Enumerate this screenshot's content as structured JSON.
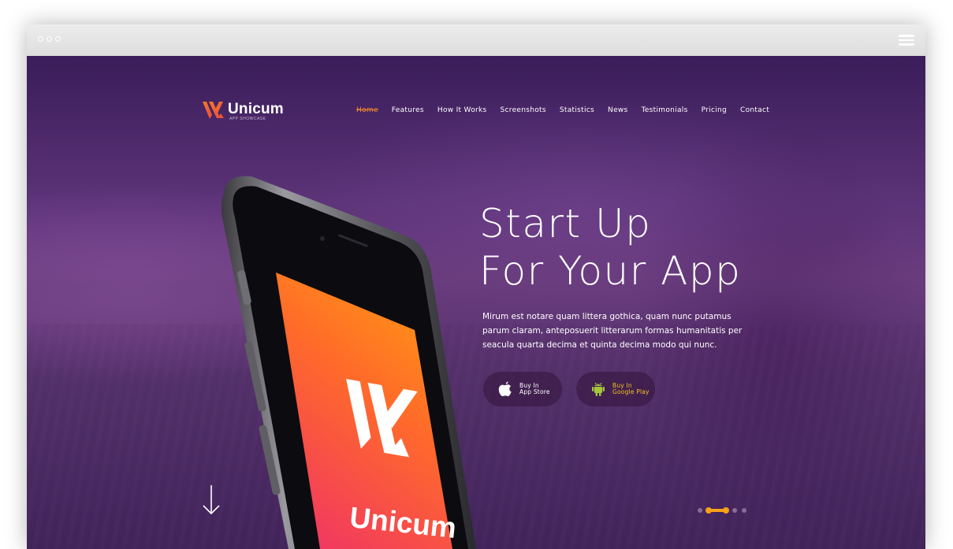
{
  "brand": {
    "name": "Unicum",
    "tagline": "APP SHOWCASE",
    "accent": "#f48a2c",
    "purple": "#4a2a62"
  },
  "nav": {
    "items": [
      {
        "label": "Home",
        "active": true
      },
      {
        "label": "Features",
        "active": false
      },
      {
        "label": "How It Works",
        "active": false
      },
      {
        "label": "Screenshots",
        "active": false
      },
      {
        "label": "Statistics",
        "active": false
      },
      {
        "label": "News",
        "active": false
      },
      {
        "label": "Testimonials",
        "active": false
      },
      {
        "label": "Pricing",
        "active": false
      },
      {
        "label": "Contact",
        "active": false
      }
    ]
  },
  "hero": {
    "headline_line1": "Start Up",
    "headline_line2": "For Your App",
    "description": "Mirum est notare quam littera gothica, quam nunc putamus parum claram, anteposuerit litterarum formas humanitatis per seacula quarta decima et quinta decima modo qui nunc.",
    "buttons": {
      "apple": {
        "line1": "Buy In",
        "line2": "App Store",
        "icon": "apple-icon"
      },
      "android": {
        "line1": "Buy In",
        "line2": "Google Play",
        "icon": "android-icon"
      }
    },
    "phone_screen_text": "Unicum"
  },
  "slider": {
    "slide_count": 4,
    "active_index": 1
  },
  "icons": {
    "window_menu": "hamburger-menu-icon",
    "scroll": "arrow-down-icon"
  }
}
